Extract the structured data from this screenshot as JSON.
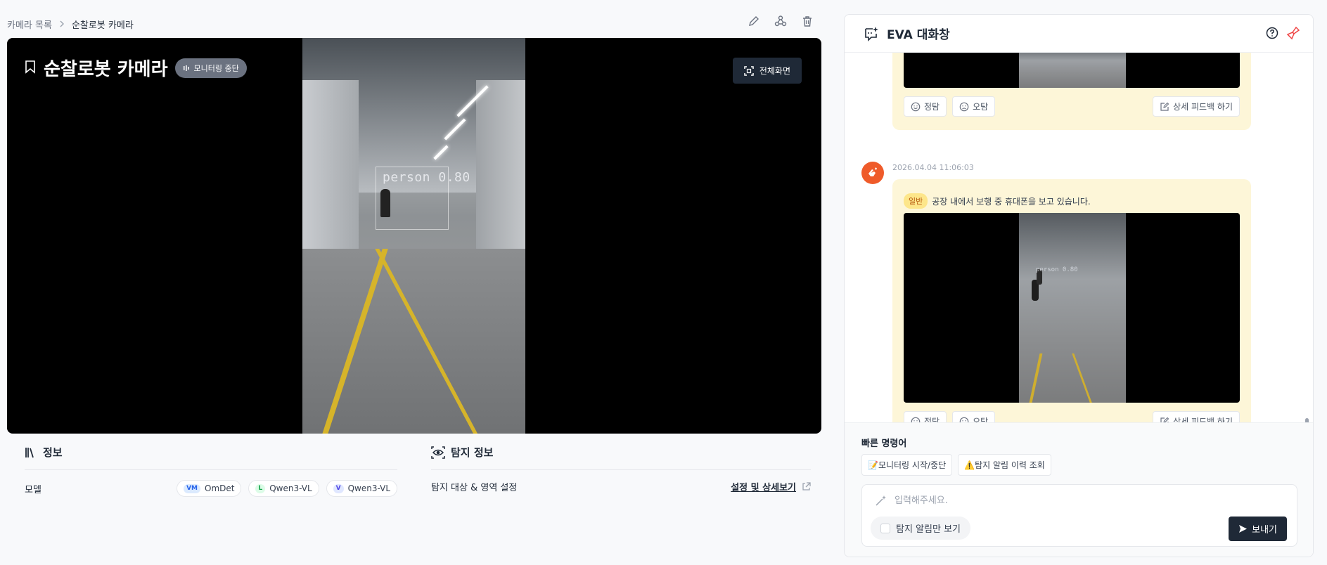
{
  "breadcrumb": {
    "parent": "카메라 목록",
    "current": "순찰로봇 카메라"
  },
  "camera": {
    "title": "순찰로봇 카메라",
    "status_badge": "모니터링 중단",
    "fullscreen_label": "전체화면",
    "detection_label": "person 0.80"
  },
  "info": {
    "title": "정보",
    "model_label": "모델",
    "models": [
      {
        "mark": "VM",
        "name": "OmDet",
        "color": "#2563eb"
      },
      {
        "mark": "L",
        "name": "Qwen3-VL",
        "color": "#16a34a"
      },
      {
        "mark": "V",
        "name": "Qwen3-VL",
        "color": "#4f46e5"
      }
    ]
  },
  "detection": {
    "title": "탐지 정보",
    "target_label": "탐지 대상 & 영역 설정",
    "link_label": "설정 및 상세보기"
  },
  "chat": {
    "title": "EVA 대화창",
    "messages": [
      {
        "feedback": {
          "correct": "정탐",
          "wrong": "오탐",
          "detail": "상세 피드백 하기"
        }
      },
      {
        "time": "2026.04.04 11:06:03",
        "tag": "일반",
        "text": "공장 내에서 보행 중 휴대폰을 보고 있습니다.",
        "detection_label": "person 0.80",
        "feedback": {
          "correct": "정탐",
          "wrong": "오탐",
          "detail": "상세 피드백 하기"
        }
      }
    ],
    "quick": {
      "title": "빠른 명령어",
      "items": [
        "📝모니터링 시작/중단",
        "⚠️탐지 알림 이력 조회"
      ]
    },
    "input": {
      "placeholder": "입력해주세요.",
      "value": ""
    },
    "toggle_label": "탐지 알림만 보기",
    "send_label": "보내기"
  },
  "colors": {
    "accent": "#1f2937",
    "bubble": "#fdf6d8",
    "tag": "#fde68a",
    "avatar": "#ef5b2a"
  }
}
